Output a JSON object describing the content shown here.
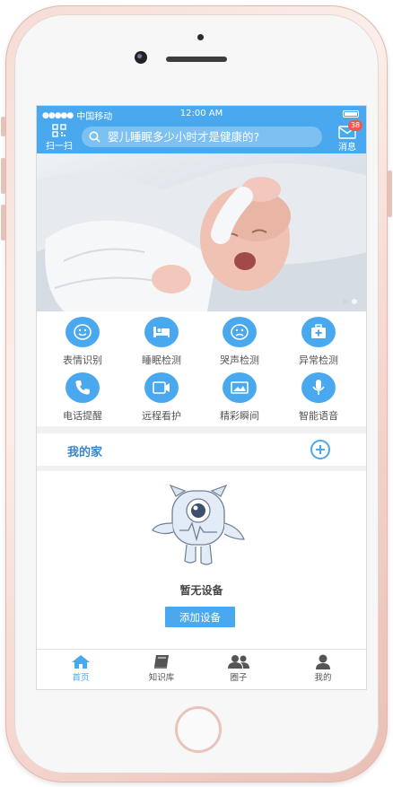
{
  "status_bar": {
    "carrier": "中国移动",
    "time": "12:00 AM"
  },
  "header": {
    "scan_label": "扫一扫",
    "search_placeholder": "婴儿睡眠多少小时才是健康的?",
    "message_label": "消息",
    "message_badge": "38"
  },
  "features": [
    {
      "label": "表情识别",
      "icon": "smiley-face-icon"
    },
    {
      "label": "睡眠检测",
      "icon": "bed-icon"
    },
    {
      "label": "哭声检测",
      "icon": "sad-face-icon"
    },
    {
      "label": "异常检测",
      "icon": "medical-kit-icon"
    },
    {
      "label": "电话提醒",
      "icon": "phone-icon"
    },
    {
      "label": "远程看护",
      "icon": "video-camera-icon"
    },
    {
      "label": "精彩瞬间",
      "icon": "picture-icon"
    },
    {
      "label": "智能语音",
      "icon": "microphone-icon"
    }
  ],
  "my_home": {
    "title": "我的家"
  },
  "empty_state": {
    "message": "暂无设备",
    "add_button": "添加设备"
  },
  "tabs": [
    {
      "label": "首页",
      "icon": "home-icon",
      "active": true
    },
    {
      "label": "知识库",
      "icon": "book-icon",
      "active": false
    },
    {
      "label": "圈子",
      "icon": "people-icon",
      "active": false
    },
    {
      "label": "我的",
      "icon": "person-icon",
      "active": false
    }
  ],
  "colors": {
    "accent": "#4aa9ee",
    "badge": "#f3564e",
    "frame": "#f3d2ca"
  }
}
